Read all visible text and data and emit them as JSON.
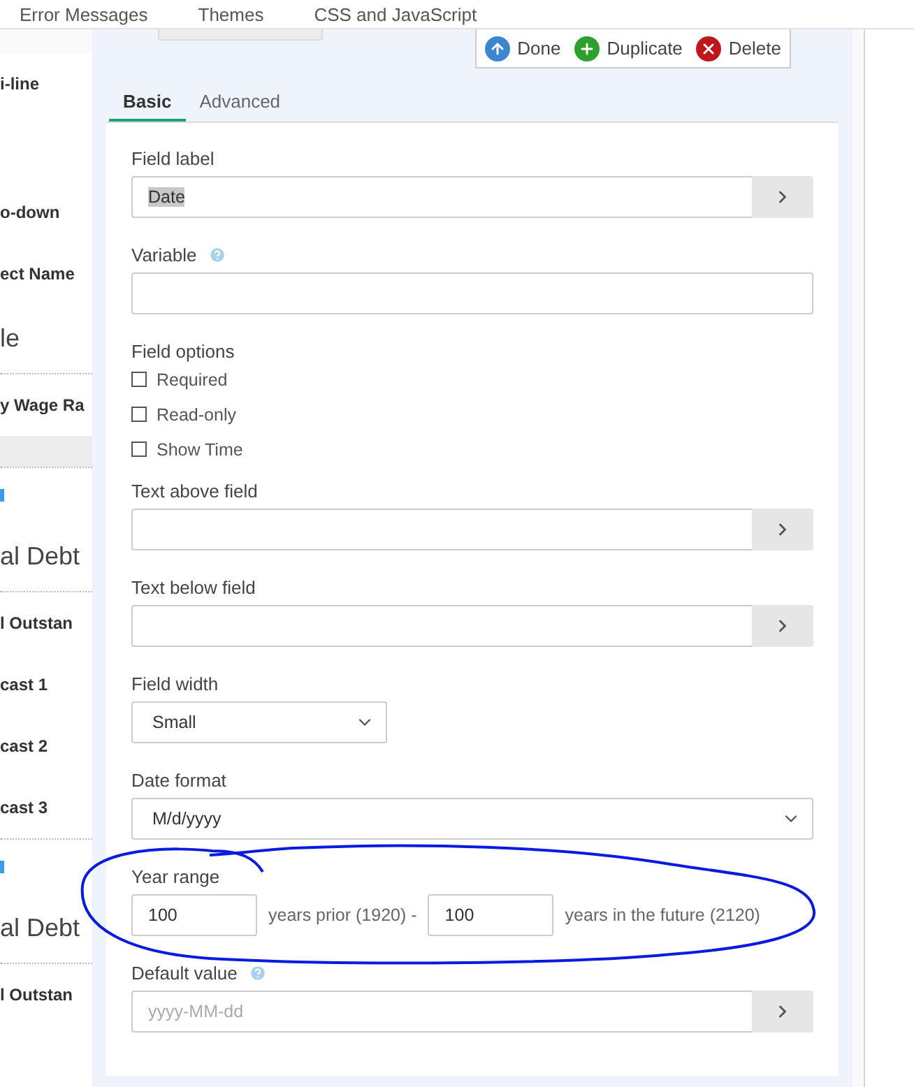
{
  "nav_tabs": [
    "Error Messages",
    "Themes",
    "CSS and JavaScript"
  ],
  "sidebar": {
    "items": [
      {
        "kind": "label",
        "text": "i-line"
      },
      {
        "kind": "label",
        "text": "o-down"
      },
      {
        "kind": "label",
        "text": "ect Name"
      },
      {
        "kind": "heading",
        "text": "le"
      },
      {
        "kind": "label",
        "text": "y Wage Ra"
      },
      {
        "kind": "bar"
      },
      {
        "kind": "link-mark"
      },
      {
        "kind": "heading",
        "text": "al Debt"
      },
      {
        "kind": "label",
        "text": "l Outstan"
      },
      {
        "kind": "label",
        "text": "cast 1"
      },
      {
        "kind": "label",
        "text": "cast 2"
      },
      {
        "kind": "label",
        "text": "cast 3"
      },
      {
        "kind": "link-mark"
      },
      {
        "kind": "heading",
        "text": "al Debt"
      },
      {
        "kind": "label",
        "text": "l Outstan"
      }
    ]
  },
  "actions": [
    {
      "kind": "done",
      "label": "Done"
    },
    {
      "kind": "duplicate",
      "label": "Duplicate"
    },
    {
      "kind": "delete",
      "label": "Delete"
    }
  ],
  "tabs": [
    {
      "label": "Basic",
      "selected": true
    },
    {
      "label": "Advanced",
      "selected": false
    }
  ],
  "fields": [
    {
      "kind": "text-expand",
      "label": "Field label",
      "value": "Date",
      "value_highlighted": true
    },
    {
      "kind": "text",
      "label": "Variable",
      "help": true
    },
    {
      "kind": "checkboxes",
      "label": "Field options",
      "options": [
        {
          "label": "Required",
          "checked": false
        },
        {
          "label": "Read-only",
          "checked": false
        },
        {
          "label": "Show Time",
          "checked": false
        }
      ]
    },
    {
      "kind": "text-expand",
      "label": "Text above field"
    },
    {
      "kind": "text-expand",
      "label": "Text below field"
    },
    {
      "kind": "select-small",
      "label": "Field width",
      "value": "Small"
    },
    {
      "kind": "select",
      "label": "Date format",
      "value": "M/d/yyyy"
    },
    {
      "kind": "year-range",
      "label": "Year range",
      "prior_value": "100",
      "prior_text": "years prior (1920) -",
      "future_value": "100",
      "future_text": "years in the future (2120)"
    },
    {
      "kind": "text-expand",
      "label": "Default value",
      "help": true,
      "placeholder": "yyyy-MM-dd"
    }
  ],
  "annotation": {
    "kind": "loop"
  }
}
